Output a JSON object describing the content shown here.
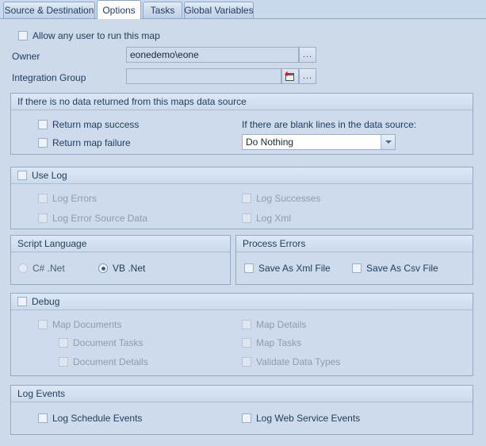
{
  "tabs": [
    {
      "label": "Source & Destination",
      "active": false
    },
    {
      "label": "Options",
      "active": true
    },
    {
      "label": "Tasks",
      "active": false
    },
    {
      "label": "Global Variables",
      "active": false
    }
  ],
  "top": {
    "allow_any_user": {
      "label": "Allow any user to run this map",
      "checked": false
    },
    "owner": {
      "label": "Owner",
      "value": "eonedemo\\eone",
      "browse": "..."
    },
    "integration_group": {
      "label": "Integration Group",
      "value": "",
      "pick_icon": "window-red-arrow-icon",
      "browse": "..."
    }
  },
  "no_data_group": {
    "title": "If there is no data returned from this maps data source",
    "return_map_success": {
      "label": "Return map success",
      "checked": false
    },
    "return_map_failure": {
      "label": "Return map failure",
      "checked": false
    },
    "blank_lines_label": "If there are blank lines in the data source:",
    "blank_lines_value": "Do Nothing"
  },
  "use_log_group": {
    "title": "Use Log",
    "checked": false,
    "items": [
      {
        "label": "Log Errors",
        "checked": false,
        "disabled": true
      },
      {
        "label": "Log Successes",
        "checked": false,
        "disabled": true
      },
      {
        "label": "Log Error Source Data",
        "checked": false,
        "disabled": true
      },
      {
        "label": "Log Xml",
        "checked": false,
        "disabled": true
      }
    ]
  },
  "script_language_group": {
    "title": "Script Language",
    "options": [
      {
        "label": "C# .Net",
        "selected": false
      },
      {
        "label": "VB .Net",
        "selected": true
      }
    ]
  },
  "process_errors_group": {
    "title": "Process Errors",
    "items": [
      {
        "label": "Save As Xml File",
        "checked": false
      },
      {
        "label": "Save As Csv File",
        "checked": false
      }
    ]
  },
  "debug_group": {
    "title": "Debug",
    "checked": false,
    "items": [
      {
        "label": "Map Documents",
        "checked": false,
        "disabled": true
      },
      {
        "label": "Map Details",
        "checked": false,
        "disabled": true
      },
      {
        "label": "Document Tasks",
        "checked": false,
        "disabled": true
      },
      {
        "label": "Map Tasks",
        "checked": false,
        "disabled": true
      },
      {
        "label": "Document Details",
        "checked": false,
        "disabled": true
      },
      {
        "label": "Validate Data Types",
        "checked": false,
        "disabled": true
      }
    ]
  },
  "log_events_group": {
    "title": "Log Events",
    "items": [
      {
        "label": "Log Schedule Events",
        "checked": false
      },
      {
        "label": "Log Web Service Events",
        "checked": false
      }
    ]
  },
  "colors": {
    "page_background": "#ccdaea",
    "group_border": "#93a9c3",
    "text": "#1d3c5c",
    "disabled_text": "#8b9cb2",
    "accent": "#2a6099",
    "icon_red": "#e01b1b"
  }
}
